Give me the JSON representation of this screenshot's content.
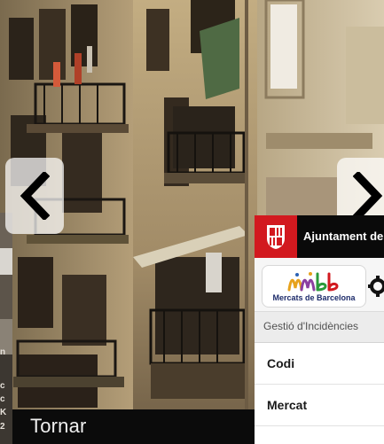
{
  "navigation": {
    "prev_icon": "chevron-left-icon",
    "next_icon": "chevron-right-icon",
    "back_label": "Tornar"
  },
  "left_peek": {
    "fragments": [
      "n",
      "c",
      "c",
      "K",
      "2"
    ]
  },
  "panel": {
    "header_title": "Ajuntament de Barcelona",
    "crest_icon": "barcelona-crest-icon",
    "logo_text": "Mercats de Barcelona",
    "logo_art_icon": "mmbb-logo-icon",
    "settings_icon": "gear-icon",
    "section_title": "Gestió d'Incidències",
    "fields": [
      {
        "label": "Codi"
      },
      {
        "label": "Mercat"
      }
    ]
  },
  "colors": {
    "header_bg": "#0a0a0a",
    "crest_red": "#d2191f",
    "back_bar_bg": "#0b0b0b",
    "logo_text": "#1d2b6a"
  }
}
